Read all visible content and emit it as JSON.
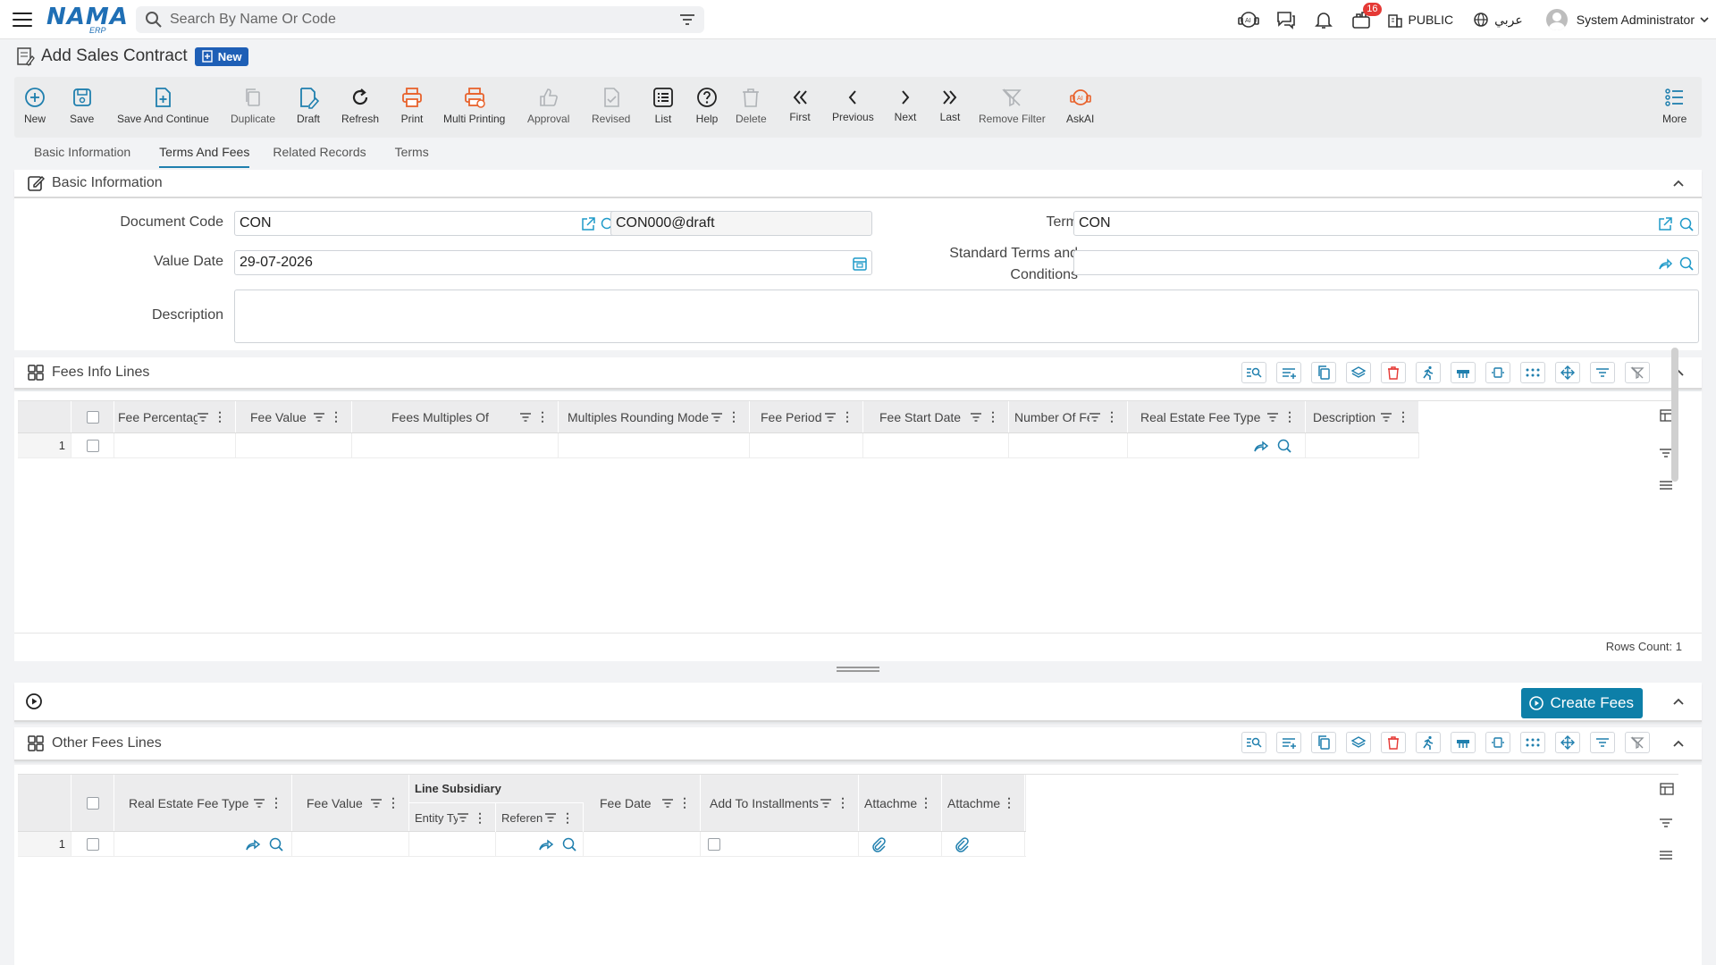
{
  "app": {
    "logo": "NAMA",
    "logo_sub": "ERP",
    "search_placeholder": "Search By Name Or Code",
    "notification_count": "16",
    "company": "PUBLIC",
    "language": "عربي",
    "user": "System Administrator"
  },
  "page": {
    "title": "Add Sales Contract",
    "status_badge": "New"
  },
  "toolbar": {
    "new": "New",
    "save": "Save",
    "save_continue": "Save And Continue",
    "duplicate": "Duplicate",
    "draft": "Draft",
    "refresh": "Refresh",
    "print": "Print",
    "multi_printing": "Multi Printing",
    "approval": "Approval",
    "revised": "Revised",
    "list": "List",
    "help": "Help",
    "delete": "Delete",
    "first": "First",
    "previous": "Previous",
    "next": "Next",
    "last": "Last",
    "remove_filter": "Remove Filter",
    "askai": "AskAI",
    "more": "More"
  },
  "tabs": [
    "Basic Information",
    "Terms And Fees",
    "Related Records",
    "Terms"
  ],
  "basic_info": {
    "title": "Basic Information",
    "document_code_label": "Document Code",
    "document_code": "CON",
    "document_code_full": "CON000@draft",
    "value_date_label": "Value Date",
    "value_date": "29-07-2026",
    "term_label": "Term",
    "term": "CON",
    "standard_terms_label_1": "Standard Terms and",
    "standard_terms_label_2": "Conditions",
    "standard_terms": "",
    "description_label": "Description",
    "description": ""
  },
  "fees_info": {
    "title": "Fees Info Lines",
    "columns": [
      "Fee Percentag",
      "Fee Value",
      "Fees Multiples Of",
      "Multiples Rounding Mode",
      "Fee Period",
      "Fee Start Date",
      "Number Of Fe",
      "Real Estate Fee Type",
      "Description"
    ],
    "row_number": "1",
    "rows_count": "Rows Count: 1"
  },
  "create_fees": "Create Fees",
  "other_fees": {
    "title": "Other Fees Lines",
    "group_header": "Line Subsidiary",
    "columns": [
      "Real Estate Fee Type",
      "Fee Value",
      "Entity Ty",
      "Referen",
      "Fee Date",
      "Add To Installments",
      "Attachme",
      "Attachme"
    ],
    "row_number": "1"
  },
  "colors": {
    "accent": "#1f7fae",
    "brand": "#1f6fb5",
    "orange": "#e8622c",
    "danger": "#e53935",
    "button": "#0d7fa8"
  }
}
